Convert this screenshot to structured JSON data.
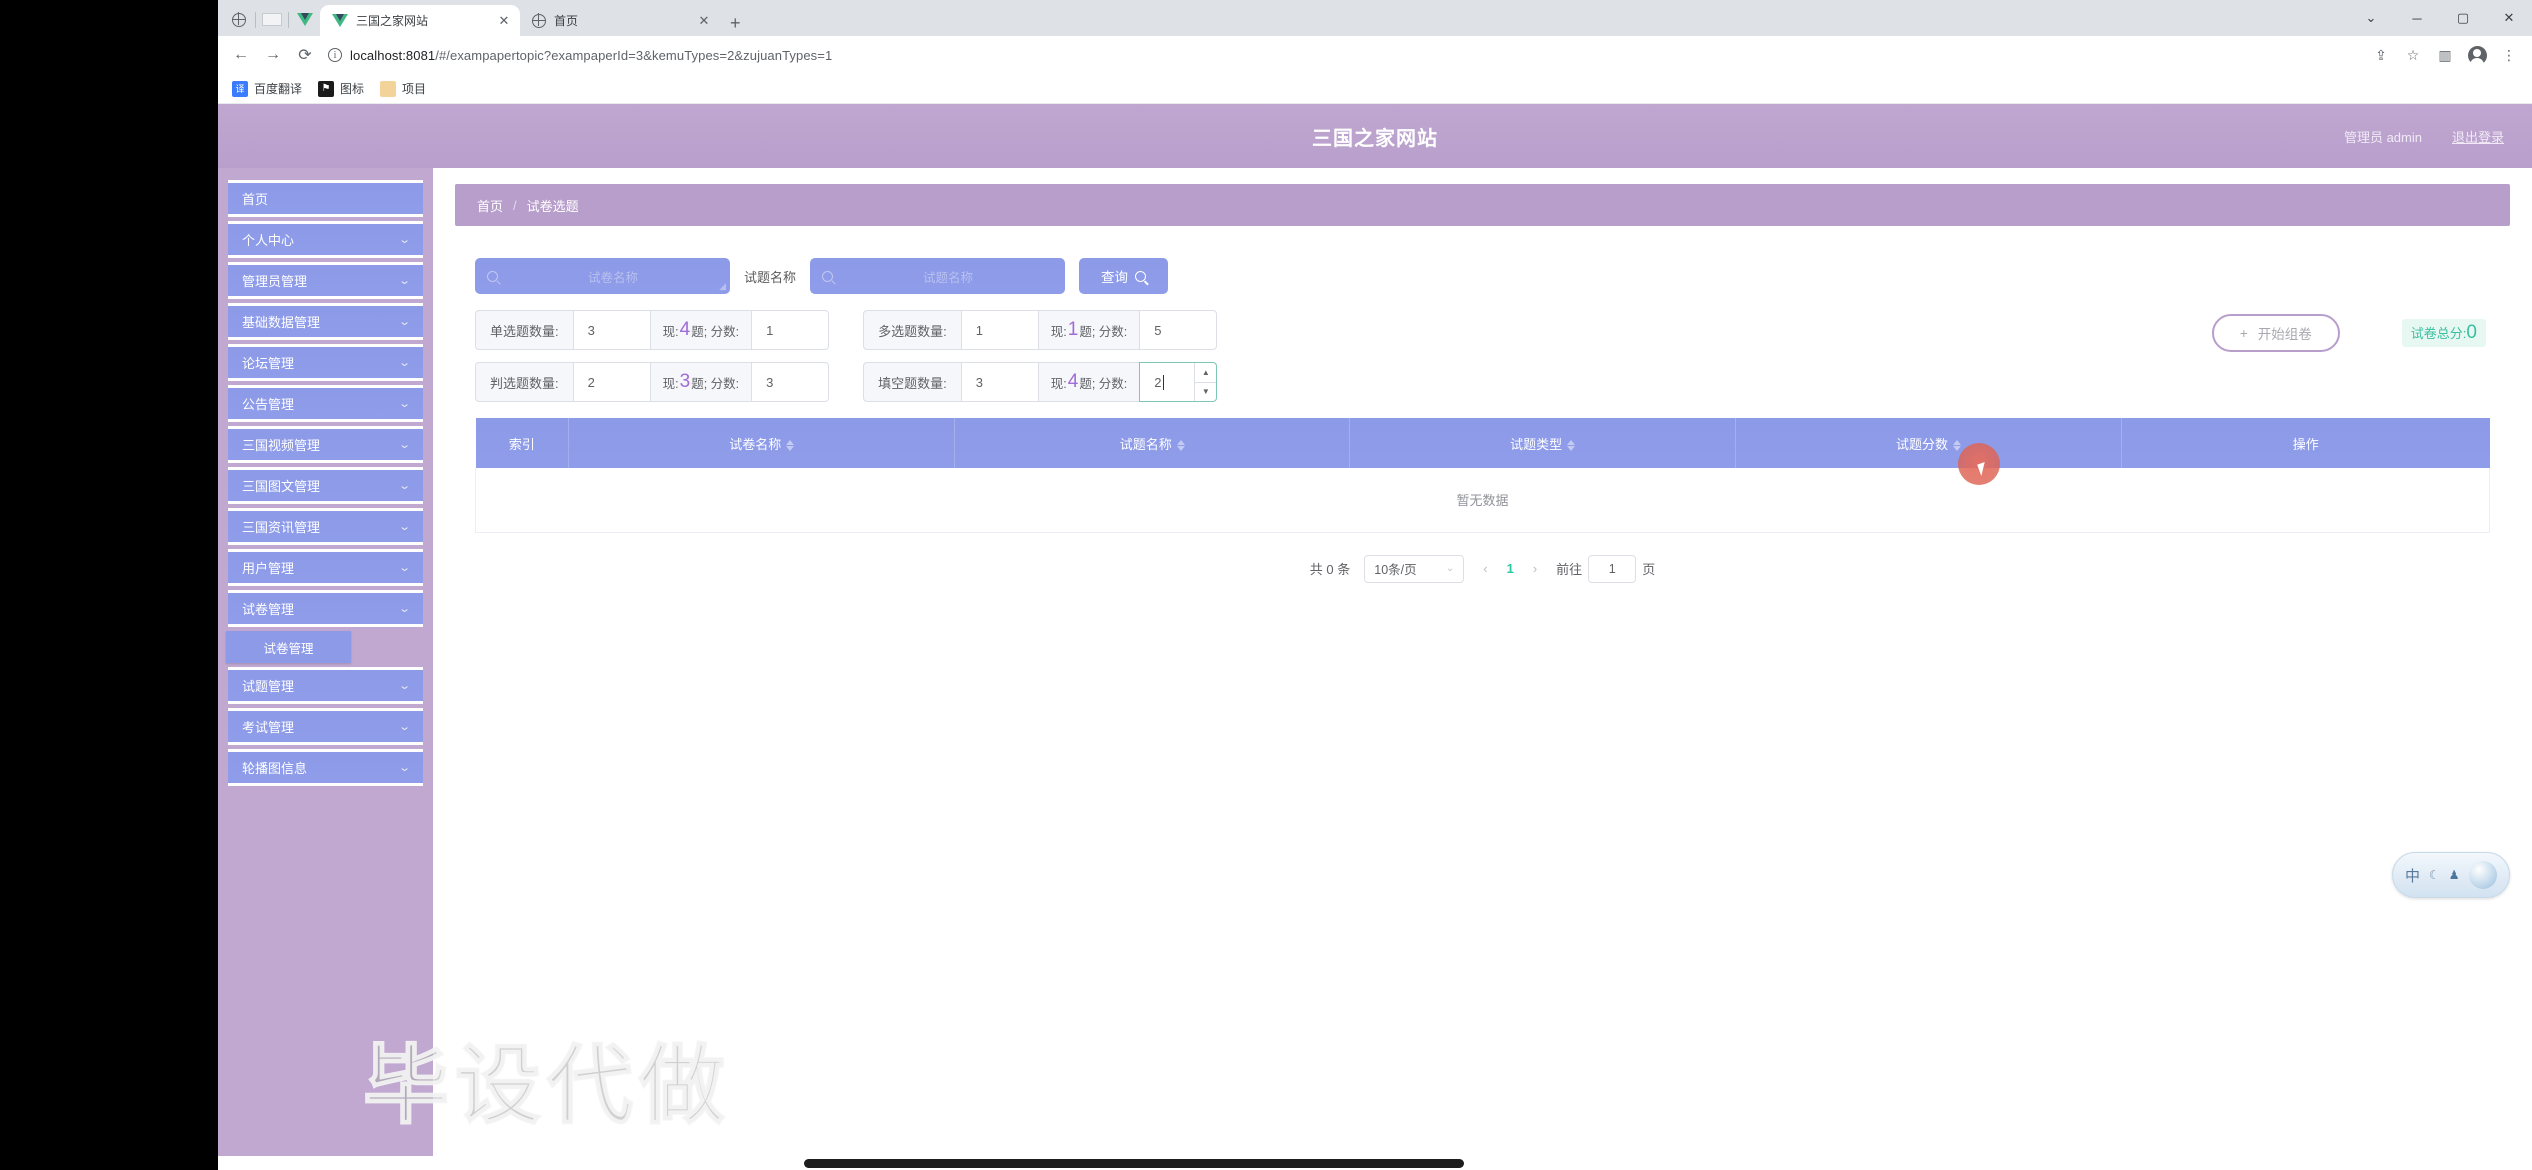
{
  "browser": {
    "tabs": [
      {
        "title": "三国之家网站",
        "icon": "vue-icon",
        "active": true
      },
      {
        "title": "首页",
        "icon": "globe-icon",
        "active": false
      }
    ],
    "new_tab_label": "+",
    "nav": {
      "back": "←",
      "forward": "→",
      "reload": "⟳"
    },
    "url": {
      "host": "localhost:8081",
      "rest": "/#/exampapertopic?exampaperId=3&kemuTypes=2&zujuanTypes=1"
    },
    "toolbar_icons": [
      "share-icon",
      "star-icon",
      "sidepanel-icon",
      "profile-icon",
      "menu-icon"
    ],
    "window_controls": {
      "minimize": "─",
      "maximize": "▢",
      "close": "✕",
      "restore": "⌄"
    },
    "bookmarks": [
      {
        "label": "百度翻译",
        "icon": "translate-icon",
        "glyph": "译"
      },
      {
        "label": "图标",
        "icon": "flag-icon",
        "glyph": "⚑"
      },
      {
        "label": "项目",
        "icon": "folder-icon",
        "glyph": ""
      }
    ]
  },
  "app": {
    "title": "三国之家网站",
    "user_label": "管理员 admin",
    "logout_label": "退出登录",
    "accent_purple": "#b79ecb",
    "accent_blue": "#8c9ae8",
    "accent_green": "#28c8a6"
  },
  "sidebar": {
    "items": [
      {
        "label": "首页",
        "expandable": false
      },
      {
        "label": "个人中心",
        "expandable": true
      },
      {
        "label": "管理员管理",
        "expandable": true
      },
      {
        "label": "基础数据管理",
        "expandable": true
      },
      {
        "label": "论坛管理",
        "expandable": true
      },
      {
        "label": "公告管理",
        "expandable": true
      },
      {
        "label": "三国视频管理",
        "expandable": true
      },
      {
        "label": "三国图文管理",
        "expandable": true
      },
      {
        "label": "三国资讯管理",
        "expandable": true
      },
      {
        "label": "用户管理",
        "expandable": true
      },
      {
        "label": "试卷管理",
        "expandable": true
      },
      {
        "label": "试题管理",
        "expandable": true
      },
      {
        "label": "考试管理",
        "expandable": true
      },
      {
        "label": "轮播图信息",
        "expandable": true
      }
    ],
    "submenu_label": "试卷管理",
    "chevron": "⌄"
  },
  "breadcrumb": {
    "home": "首页",
    "separator": "/",
    "current": "试卷选题"
  },
  "search": {
    "paper_placeholder": "试卷名称",
    "topic_field_label": "试题名称",
    "topic_placeholder": "试题名称",
    "query_button": "查询"
  },
  "counts": [
    {
      "label": "单选题数量:",
      "value": "3",
      "current_prefix": "现:",
      "current_num": "4",
      "current_suffix": "题;",
      "score_label": "分数:",
      "score": "1",
      "focused": false
    },
    {
      "label": "多选题数量:",
      "value": "1",
      "current_prefix": "现:",
      "current_num": "1",
      "current_suffix": "题;",
      "score_label": "分数:",
      "score": "5",
      "focused": false
    },
    {
      "label": "判选题数量:",
      "value": "2",
      "current_prefix": "现:",
      "current_num": "3",
      "current_suffix": "题;",
      "score_label": "分数:",
      "score": "3",
      "focused": false
    },
    {
      "label": "填空题数量:",
      "value": "3",
      "current_prefix": "现:",
      "current_num": "4",
      "current_suffix": "题;",
      "score_label": "分数:",
      "score": "2",
      "focused": true
    }
  ],
  "actions": {
    "start_button": "开始组卷",
    "start_button_plus": "+",
    "total_score_label": "试卷总分:",
    "total_score_value": "0"
  },
  "table": {
    "columns": [
      {
        "label": "索引",
        "sortable": false
      },
      {
        "label": "试卷名称",
        "sortable": true
      },
      {
        "label": "试题名称",
        "sortable": true
      },
      {
        "label": "试题类型",
        "sortable": true
      },
      {
        "label": "试题分数",
        "sortable": true
      },
      {
        "label": "操作",
        "sortable": false
      }
    ],
    "rows": [],
    "empty_text": "暂无数据"
  },
  "pagination": {
    "total_text": "共 0 条",
    "page_size": "10条/页",
    "prev": "‹",
    "next": "›",
    "current_page": "1",
    "goto_label": "前往",
    "goto_value": "1",
    "page_unit": "页"
  },
  "watermark": "毕设代做",
  "ime": {
    "mode": "中",
    "moon": "☾",
    "shirt": "♟"
  }
}
